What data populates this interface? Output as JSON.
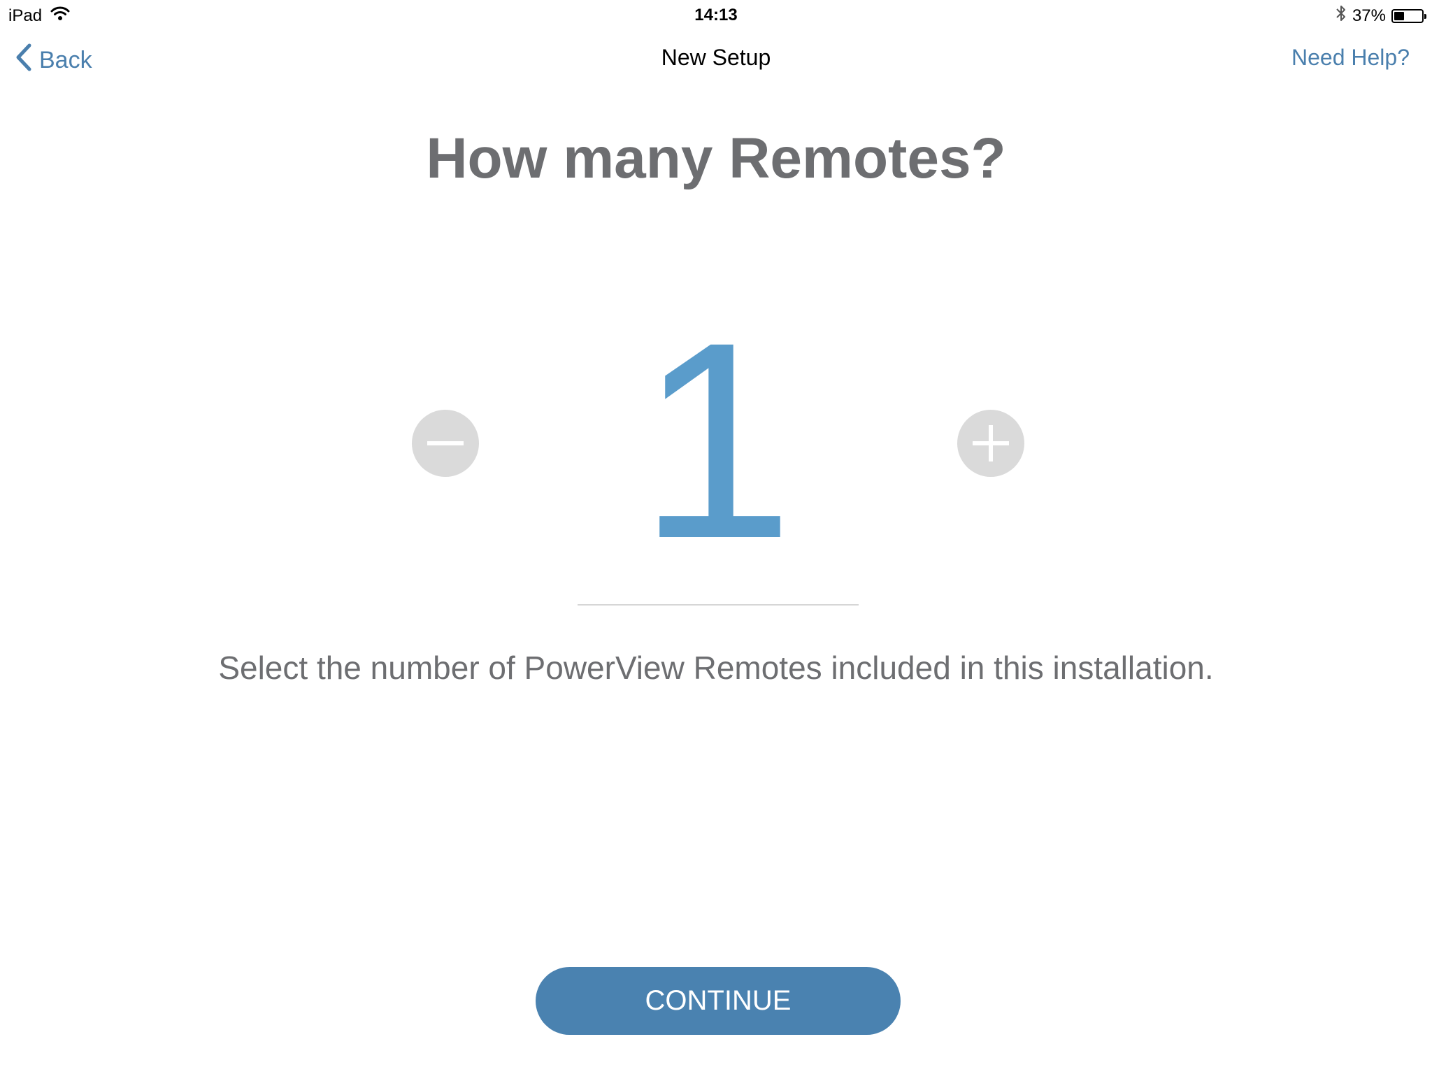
{
  "status_bar": {
    "device": "iPad",
    "time": "14:13",
    "battery_percent_label": "37%",
    "battery_level": 0.37,
    "icons": [
      "wifi-icon",
      "bluetooth-icon",
      "battery-icon"
    ]
  },
  "nav": {
    "back_label": "Back",
    "title": "New Setup",
    "help_label": "Need Help?"
  },
  "main": {
    "heading": "How many Remotes?",
    "count": "1",
    "description": "Select the number of PowerView Remotes included in this installation.",
    "continue_label": "CONTINUE"
  },
  "colors": {
    "accent": "#4a7fad",
    "count": "#5a9ccb",
    "button": "#4a82b0",
    "text_gray": "#6d6e71",
    "stepper_bg": "#dadada"
  }
}
